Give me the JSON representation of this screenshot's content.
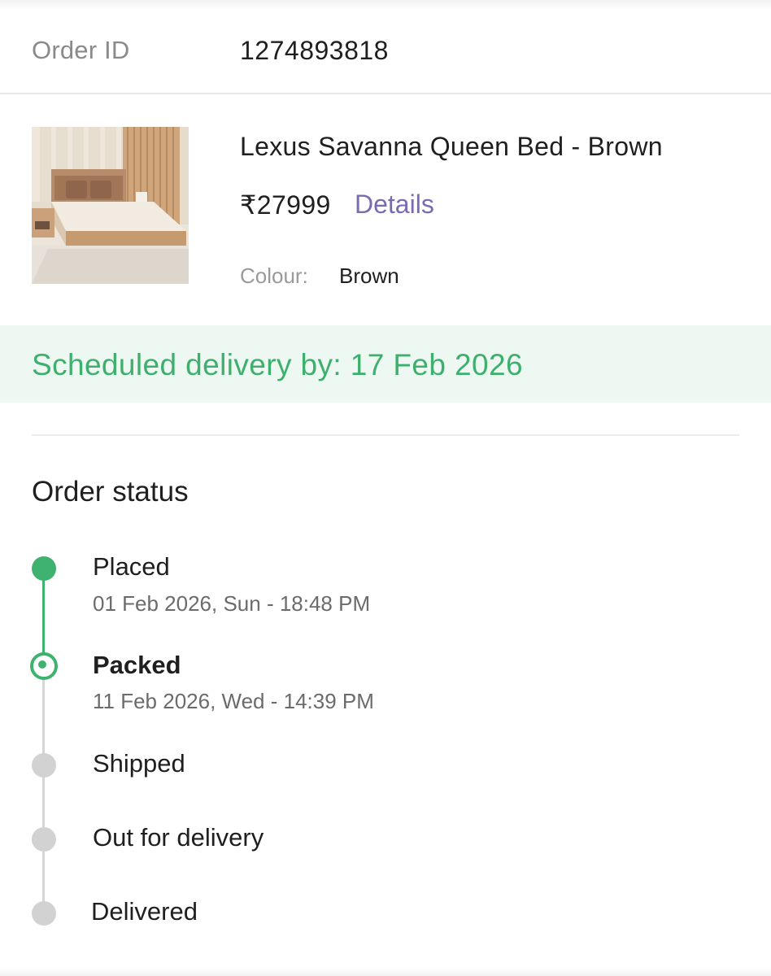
{
  "order": {
    "id_label": "Order ID",
    "id_value": "1274893818"
  },
  "product": {
    "title": "Lexus Savanna Queen Bed - Brown",
    "price": "₹27999",
    "details_link": "Details",
    "colour_label": "Colour:",
    "colour_value": "Brown",
    "image_icon": "bed-product-photo"
  },
  "delivery": {
    "text": "Scheduled delivery by: 17 Feb 2026"
  },
  "status": {
    "title": "Order status",
    "steps": [
      {
        "label": "Placed",
        "time": "01 Feb 2026, Sun - 18:48 PM",
        "state": "done"
      },
      {
        "label": "Packed",
        "time": "11 Feb 2026, Wed - 14:39 PM",
        "state": "current"
      },
      {
        "label": "Shipped",
        "time": "",
        "state": "pending"
      },
      {
        "label": "Out for delivery",
        "time": "",
        "state": "pending"
      },
      {
        "label": "Delivered",
        "time": "",
        "state": "pending"
      }
    ]
  },
  "colors": {
    "green": "#3fb26f",
    "pending_gray": "#d2d2d2",
    "link_purple": "#7b6bb2",
    "banner_bg": "#edf8f2"
  }
}
